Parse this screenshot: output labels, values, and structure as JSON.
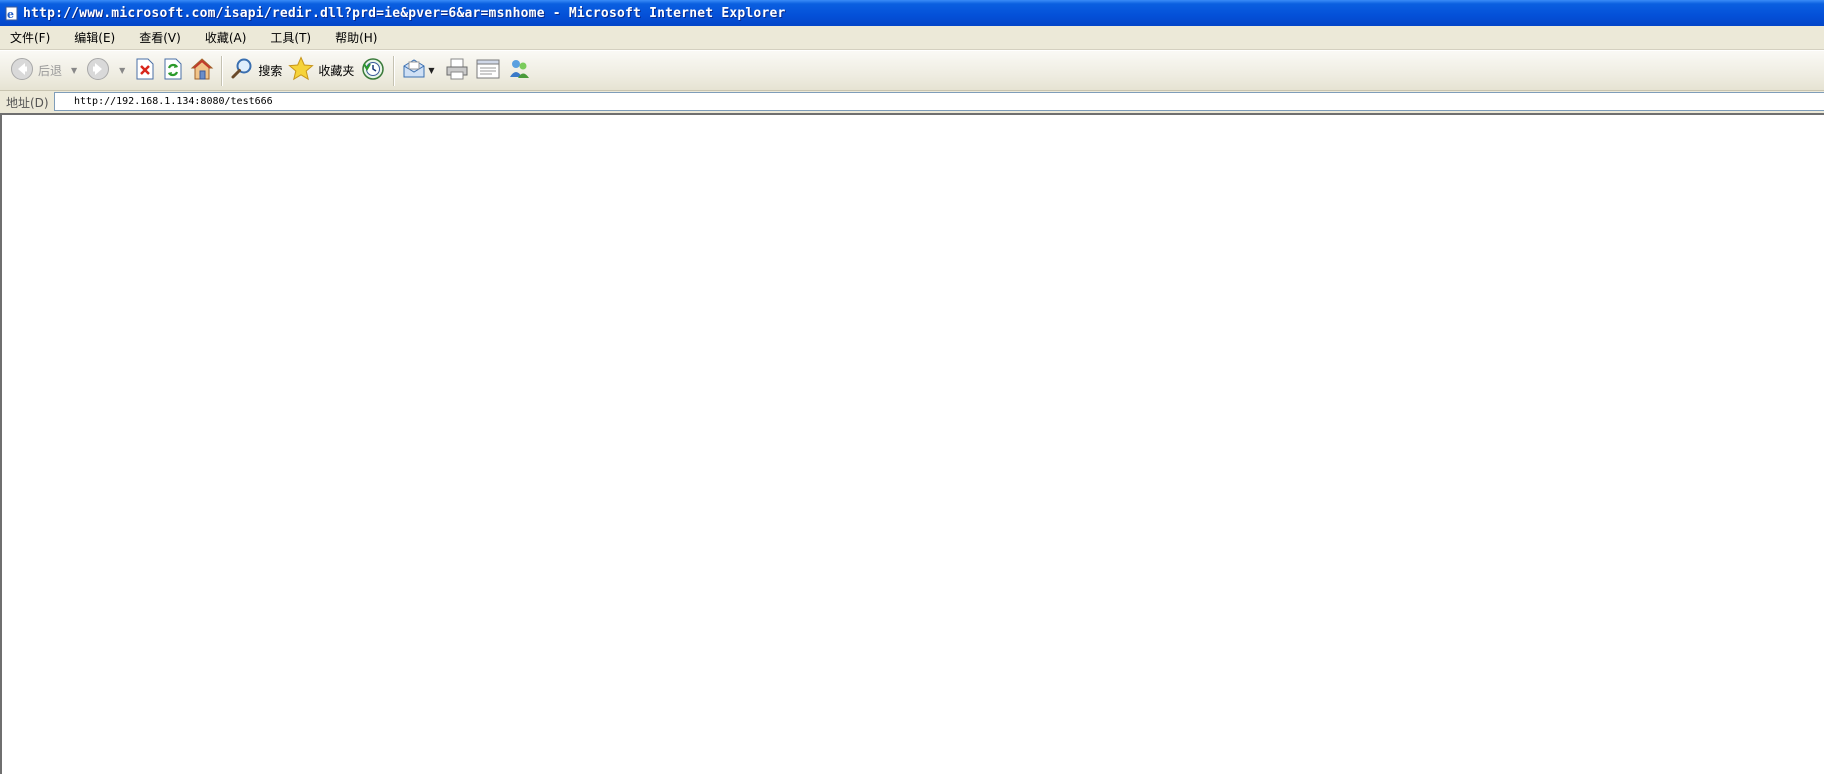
{
  "window": {
    "title": "http://www.microsoft.com/isapi/redir.dll?prd=ie&pver=6&ar=msnhome - Microsoft Internet Explorer",
    "icon": "ie-page-icon"
  },
  "menubar": {
    "items": [
      {
        "label": "文件(F)"
      },
      {
        "label": "编辑(E)"
      },
      {
        "label": "查看(V)"
      },
      {
        "label": "收藏(A)"
      },
      {
        "label": "工具(T)"
      },
      {
        "label": "帮助(H)"
      }
    ]
  },
  "toolbar": {
    "back_label": "后退",
    "search_label": "搜索",
    "favorites_label": "收藏夹",
    "icons": [
      "back-arrow-icon",
      "forward-arrow-icon",
      "stop-icon",
      "refresh-icon",
      "home-icon",
      "search-icon",
      "favorites-star-icon",
      "history-icon",
      "mail-icon",
      "print-icon",
      "edit-icon",
      "messenger-icon"
    ]
  },
  "address": {
    "label": "地址(D)",
    "url": "http://192.168.1.134:8080/test666"
  },
  "colors": {
    "titlebar": "#0450d8",
    "chrome": "#ece9d8",
    "content": "#ffffff"
  }
}
